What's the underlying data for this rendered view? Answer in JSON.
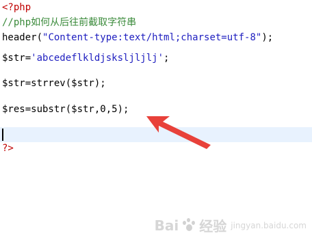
{
  "code_lines": [
    {
      "text": "<?php",
      "kind": "php-tag"
    },
    {
      "text": "//php如何从后往前截取字符串",
      "kind": "comment"
    },
    {
      "prefix": "header(",
      "string": "\"Content-type:text/html;charset=utf-8\"",
      "suffix": ");"
    },
    {
      "text": ""
    },
    {
      "prefix": "$str=",
      "string": "'abcedeflkldjsksljljlj'",
      "suffix": ";"
    },
    {
      "text": ""
    },
    {
      "text": "$str=strrev($str);"
    },
    {
      "text": ""
    },
    {
      "text": "$res=substr($str,0,5);"
    },
    {
      "text": ""
    },
    {
      "text": "?>",
      "kind": "php-tag"
    }
  ],
  "watermark": {
    "brand": "Bai",
    "brand2": "经验",
    "sub": "jingyan.baidu.com"
  },
  "colors": {
    "php_tag": "#c00000",
    "comment": "#3a8a3a",
    "string": "#2020c0",
    "current_line": "#e8f2fe",
    "arrow": "#e8413a"
  }
}
